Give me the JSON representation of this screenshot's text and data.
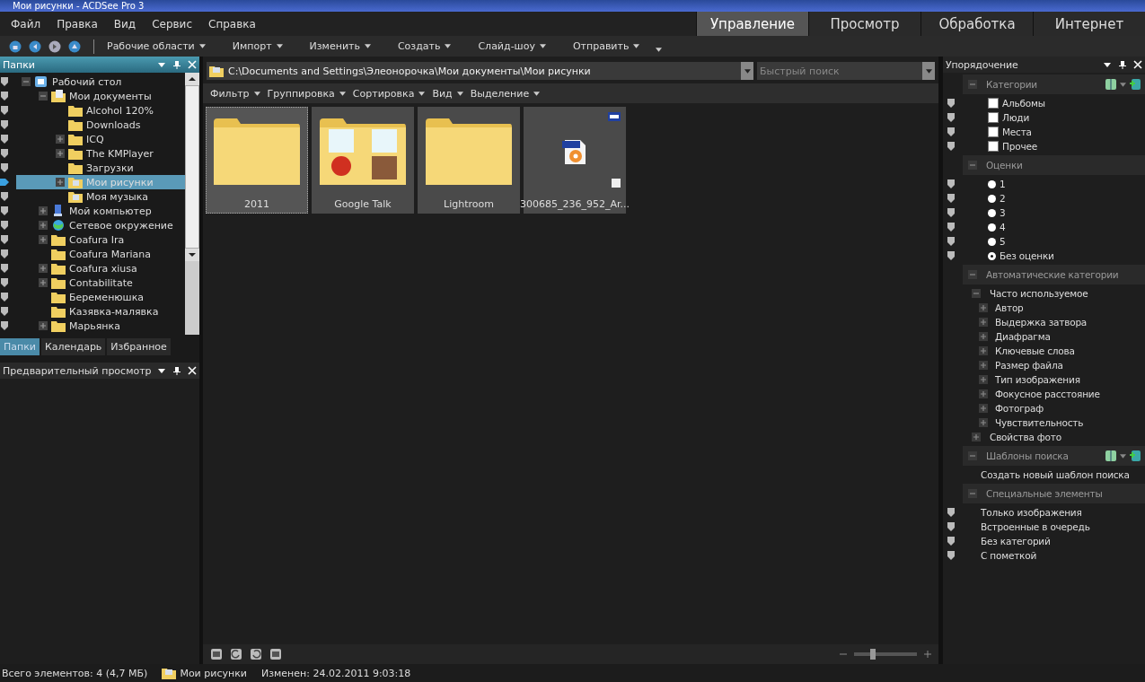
{
  "window": {
    "title": "Мои рисунки - ACDSee Pro 3"
  },
  "menu": [
    "Файл",
    "Правка",
    "Вид",
    "Сервис",
    "Справка"
  ],
  "modes": [
    {
      "label": "Управление",
      "selected": true
    },
    {
      "label": "Просмотр",
      "selected": false
    },
    {
      "label": "Обработка",
      "selected": false
    },
    {
      "label": "Интернет",
      "selected": false
    }
  ],
  "toolbar": [
    "Рабочие области",
    "Импорт",
    "Изменить",
    "Создать",
    "Слайд-шоу",
    "Отправить"
  ],
  "folders_panel": {
    "title": "Папки",
    "tree": [
      {
        "label": "Рабочий стол",
        "kind": "desktop",
        "expanded": true,
        "selected": false,
        "children": [
          {
            "label": "Мои документы",
            "kind": "documents",
            "expanded": true,
            "selected": false,
            "children": [
              {
                "label": "Alcohol 120%",
                "kind": "folder",
                "selected": false
              },
              {
                "label": "Downloads",
                "kind": "folder",
                "selected": false
              },
              {
                "label": "ICQ",
                "kind": "folder",
                "expanded": false,
                "selected": false
              },
              {
                "label": "The KMPlayer",
                "kind": "folder",
                "expanded": false,
                "selected": false
              },
              {
                "label": "Загрузки",
                "kind": "folder",
                "selected": false
              },
              {
                "label": "Мои рисунки",
                "kind": "pictures",
                "expanded": false,
                "selected": true
              },
              {
                "label": "Моя музыка",
                "kind": "music",
                "selected": false
              }
            ]
          },
          {
            "label": "Мой компьютер",
            "kind": "computer",
            "expanded": false,
            "selected": false
          },
          {
            "label": "Сетевое окружение",
            "kind": "network",
            "expanded": false,
            "selected": false
          },
          {
            "label": "Coafura Ira",
            "kind": "folder",
            "expanded": false,
            "selected": false
          },
          {
            "label": "Coafura Mariana",
            "kind": "folder",
            "selected": false
          },
          {
            "label": "Coafura xiusa",
            "kind": "folder",
            "expanded": false,
            "selected": false
          },
          {
            "label": "Contabilitate",
            "kind": "folder",
            "expanded": false,
            "selected": false
          },
          {
            "label": "Беременюшка",
            "kind": "folder",
            "selected": false
          },
          {
            "label": "Казявка-малявка",
            "kind": "folder",
            "selected": false
          },
          {
            "label": "Марьянка",
            "kind": "folder",
            "expanded": false,
            "selected": false
          }
        ]
      }
    ],
    "tabs": [
      {
        "label": "Папки",
        "selected": true
      },
      {
        "label": "Календарь",
        "selected": false
      },
      {
        "label": "Избранное",
        "selected": false
      }
    ]
  },
  "preview_panel": {
    "title": "Предварительный просмотр"
  },
  "address": {
    "path": "C:\\Documents and Settings\\Элеонорочка\\Мои документы\\Мои рисунки",
    "search_placeholder": "Быстрый поиск"
  },
  "view_bar": [
    "Фильтр",
    "Группировка",
    "Сортировка",
    "Вид",
    "Выделение"
  ],
  "items": [
    {
      "name": "2011",
      "kind": "folder",
      "selected": true
    },
    {
      "name": "Google Talk",
      "kind": "image-folder",
      "selected": false
    },
    {
      "name": "Lightroom",
      "kind": "folder",
      "selected": false
    },
    {
      "name": "300685_236_952_Ar...",
      "kind": "bmp",
      "selected": false
    }
  ],
  "zoom": {
    "level": 0.3
  },
  "organize_panel": {
    "title": "Упорядочение",
    "sections": [
      {
        "title": "Категории",
        "tools": true,
        "items": [
          {
            "kind": "checkbox",
            "label": "Альбомы",
            "checked": false
          },
          {
            "kind": "checkbox",
            "label": "Люди",
            "checked": false
          },
          {
            "kind": "checkbox",
            "label": "Места",
            "checked": false
          },
          {
            "kind": "checkbox",
            "label": "Прочее",
            "checked": false
          }
        ]
      },
      {
        "title": "Оценки",
        "tools": false,
        "items": [
          {
            "kind": "radio",
            "label": "1",
            "selected": false
          },
          {
            "kind": "radio",
            "label": "2",
            "selected": false
          },
          {
            "kind": "radio",
            "label": "3",
            "selected": false
          },
          {
            "kind": "radio",
            "label": "4",
            "selected": false
          },
          {
            "kind": "radio",
            "label": "5",
            "selected": false
          },
          {
            "kind": "radio",
            "label": "Без оценки",
            "selected": true
          }
        ]
      },
      {
        "title": "Автоматические категории",
        "tools": false,
        "items": [
          {
            "kind": "tree",
            "label": "Часто используемое",
            "expanded": true,
            "children": [
              {
                "label": "Автор"
              },
              {
                "label": "Выдержка затвора"
              },
              {
                "label": "Диафрагма"
              },
              {
                "label": "Ключевые слова"
              },
              {
                "label": "Размер файла"
              },
              {
                "label": "Тип изображения"
              },
              {
                "label": "Фокусное расстояние"
              },
              {
                "label": "Фотограф"
              },
              {
                "label": "Чувствительность"
              }
            ]
          },
          {
            "kind": "tree",
            "label": "Свойства фото",
            "expanded": false
          }
        ]
      },
      {
        "title": "Шаблоны поиска",
        "tools": true,
        "items": [
          {
            "kind": "link",
            "label": "Создать новый шаблон поиска"
          }
        ]
      },
      {
        "title": "Специальные элементы",
        "tools": false,
        "items": [
          {
            "kind": "special",
            "label": "Только изображения"
          },
          {
            "kind": "special",
            "label": "Встроенные в очередь"
          },
          {
            "kind": "special",
            "label": "Без категорий"
          },
          {
            "kind": "special",
            "label": "С пометкой"
          }
        ]
      }
    ]
  },
  "status_bar": {
    "count": "Всего элементов: 4  (4,7 МБ)",
    "folder": "Мои рисунки",
    "modified": "Изменен: 24.02.2011 9:03:18"
  }
}
